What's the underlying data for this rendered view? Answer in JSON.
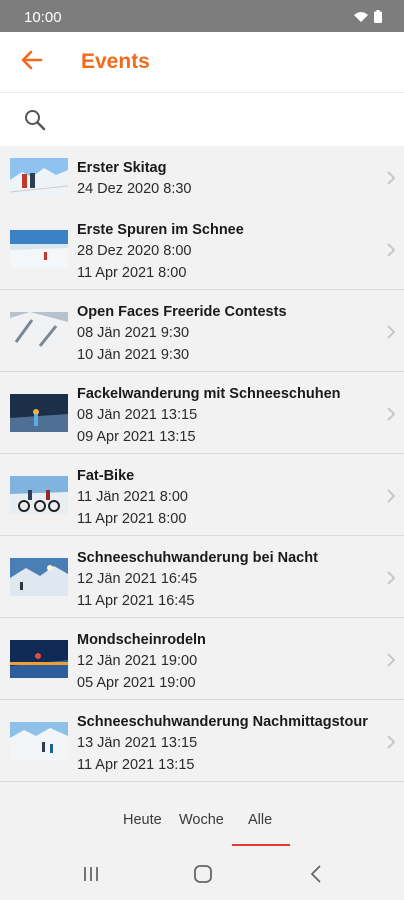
{
  "status": {
    "time": "10:00"
  },
  "header": {
    "title": "Events"
  },
  "search": {
    "value": "",
    "placeholder": ""
  },
  "events": [
    {
      "title": "Erster Skitag",
      "start": "24 Dez 2020 8:30",
      "end": "",
      "thumb": "skitag"
    },
    {
      "title": "Erste Spuren im Schnee",
      "start": "28 Dez 2020 8:00",
      "end": "11 Apr 2021 8:00",
      "thumb": "spuren"
    },
    {
      "title": "Open Faces Freeride Contests",
      "start": "08 Jän 2021 9:30",
      "end": "10 Jän 2021 9:30",
      "thumb": "freeride"
    },
    {
      "title": "Fackelwanderung mit Schneeschuhen",
      "start": "08 Jän 2021 13:15",
      "end": "09 Apr 2021 13:15",
      "thumb": "fackel"
    },
    {
      "title": "Fat-Bike",
      "start": "11 Jän 2021 8:00",
      "end": "11 Apr 2021 8:00",
      "thumb": "fatbike"
    },
    {
      "title": "Schneeschuhwanderung bei Nacht",
      "start": "12 Jän 2021 16:45",
      "end": "11 Apr 2021 16:45",
      "thumb": "nacht"
    },
    {
      "title": "Mondscheinrodeln",
      "start": "12 Jän 2021 19:00",
      "end": "05 Apr 2021 19:00",
      "thumb": "rodeln"
    },
    {
      "title": "Schneeschuhwanderung Nachmittagstour",
      "start": "13 Jän 2021 13:15",
      "end": "11 Apr 2021 13:15",
      "thumb": "nachmittag"
    }
  ],
  "tabs": [
    {
      "label": "Heute"
    },
    {
      "label": "Woche"
    },
    {
      "label": "Alle",
      "active": true
    }
  ],
  "colors": {
    "accent": "#f26a1b",
    "tab_indicator": "#e53935",
    "status_bar": "#7d7d7d"
  },
  "icons": {
    "back": "arrow-left-icon",
    "search": "search-icon",
    "chevron": "chevron-right-icon",
    "nav": [
      "recent-apps-icon",
      "home-icon",
      "nav-back-icon"
    ]
  }
}
